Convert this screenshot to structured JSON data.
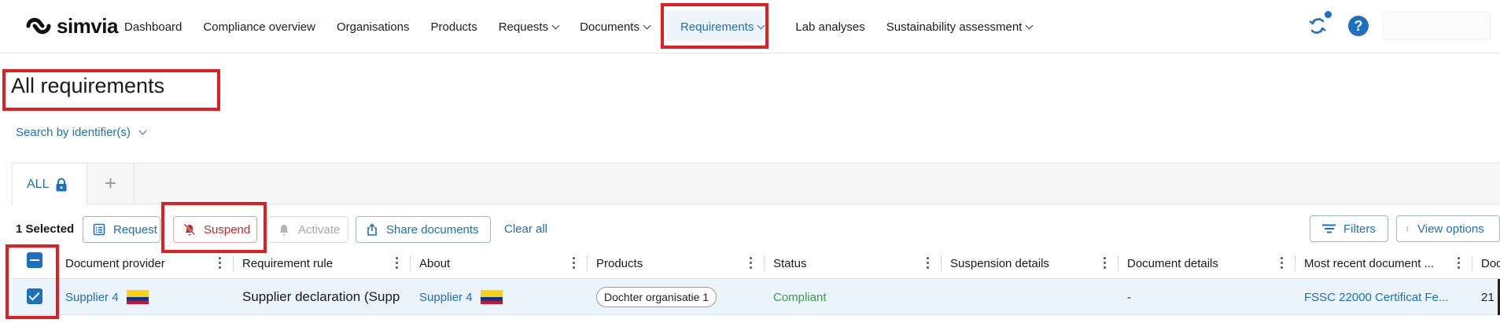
{
  "app": {
    "logo_text": "simvia"
  },
  "nav": {
    "items": [
      {
        "label": "Dashboard",
        "has_menu": false
      },
      {
        "label": "Compliance overview",
        "has_menu": false
      },
      {
        "label": "Organisations",
        "has_menu": false
      },
      {
        "label": "Products",
        "has_menu": false
      },
      {
        "label": "Requests",
        "has_menu": true
      },
      {
        "label": "Documents",
        "has_menu": true
      },
      {
        "label": "Requirements",
        "has_menu": true,
        "active": true
      },
      {
        "label": "Lab analyses",
        "has_menu": false
      },
      {
        "label": "Sustainability assessment",
        "has_menu": true
      }
    ],
    "icons": [
      "sync-icon",
      "help-icon"
    ],
    "help_glyph": "?"
  },
  "page": {
    "title": "All requirements",
    "search_toggle_label": "Search by identifier(s)"
  },
  "tabs": {
    "items": [
      {
        "label": "ALL",
        "locked": true
      }
    ],
    "add_label": "+"
  },
  "actions": {
    "selected_text": "1 Selected",
    "request_label": "Request",
    "suspend_label": "Suspend",
    "activate_label": "Activate",
    "share_label": "Share documents",
    "clear_all_label": "Clear all",
    "filters_label": "Filters",
    "view_options_label": "View options"
  },
  "table": {
    "columns": [
      "Document provider",
      "Requirement rule",
      "About",
      "Products",
      "Status",
      "Suspension details",
      "Document details",
      "Most recent document ...",
      "Doc"
    ],
    "rows": [
      {
        "selected": true,
        "document_provider": "Supplier 4",
        "requirement_rule": "Supplier declaration (Supp",
        "about": "Supplier 4",
        "product_chip": "Dochter organisatie 1",
        "status": "Compliant",
        "suspension_details": "",
        "document_details": "-",
        "most_recent_document": "FSSC 22000  Certificat Fe...",
        "doc": "21"
      }
    ]
  },
  "colors": {
    "accent": "#1c70bd",
    "highlight": "#e11e22",
    "status_compliant": "#3a9d45",
    "suspend": "#c62828"
  }
}
